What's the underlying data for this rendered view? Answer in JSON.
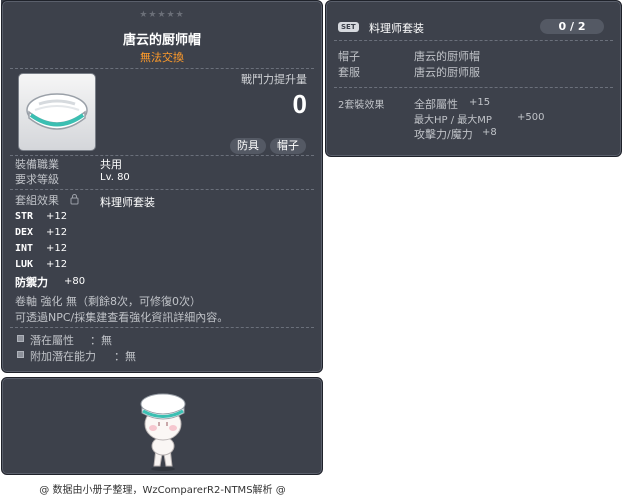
{
  "item": {
    "id": "01003762",
    "stars": "★★★★★",
    "name": "唐云的厨师帽",
    "trade_status": "無法交換",
    "power_label": "戰鬥力提升量",
    "power_value": "0",
    "tags": [
      "防具",
      "帽子"
    ],
    "job_label": "裝備職業",
    "job_value": "共用",
    "level_label": "要求等級",
    "level_value": "Lv. 80",
    "set_effect_label": "套組效果",
    "set_effect_value": "料理师套装",
    "stats": [
      {
        "name": "STR",
        "value": "+12"
      },
      {
        "name": "DEX",
        "value": "+12"
      },
      {
        "name": "INT",
        "value": "+12"
      },
      {
        "name": "LUK",
        "value": "+12"
      }
    ],
    "defense_label": "防禦力",
    "defense_value": "+80",
    "scroll_line": "卷軸 強化 無（剩餘8次，可修復0次）",
    "hint_line": "可透過NPC/採集建查看強化資訊詳細內容。",
    "potential_label": "潛在屬性",
    "potential_value": "：無",
    "bonus_potential_label": "附加潛在能力",
    "bonus_potential_value": "：無"
  },
  "set": {
    "badge": "SET",
    "name": "料理师套装",
    "count": "0 / 2",
    "parts": [
      {
        "slot": "帽子",
        "item": "唐云的厨师帽"
      },
      {
        "slot": "套服",
        "item": "唐云的厨师服"
      }
    ],
    "effect_label": "2套裝效果",
    "effects": [
      {
        "name": "全部屬性",
        "value": "+15"
      },
      {
        "name": "最大HP / 最大MP",
        "value": "+500"
      },
      {
        "name": "攻擊力/魔力",
        "value": "+8"
      }
    ]
  },
  "footer": "@ 数据由小册子整理，WzComparerR2-NTMS解析 @",
  "colors": {
    "panel_bg": "#3d414b",
    "trade_status": "#ff9b2a",
    "tag_bg": "#545964"
  }
}
